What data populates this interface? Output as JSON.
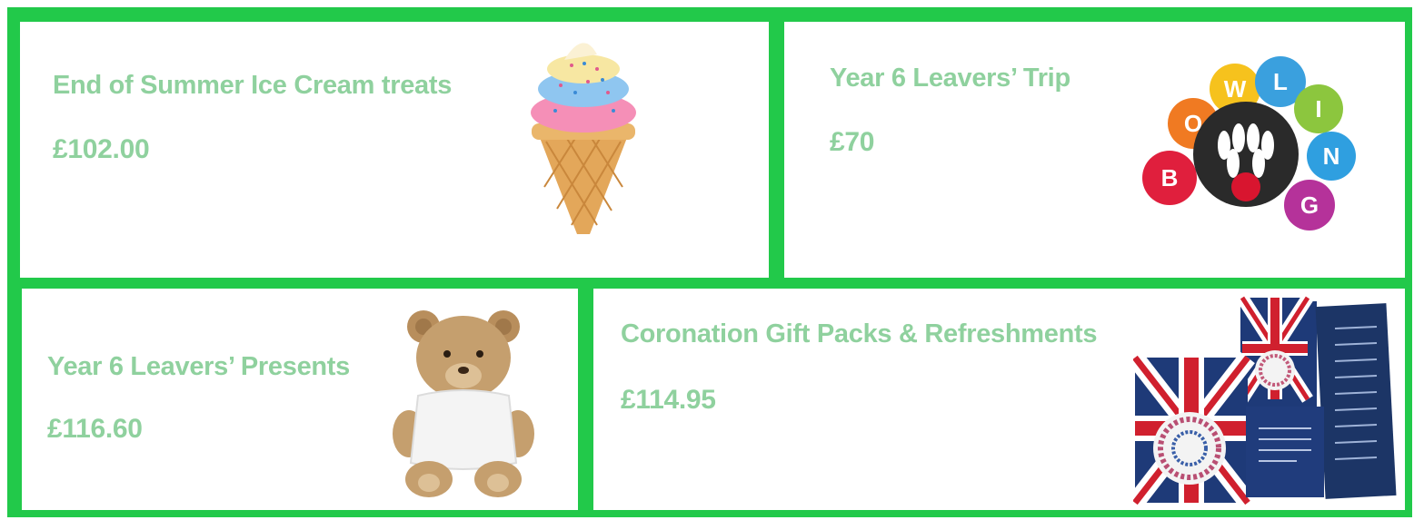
{
  "colors": {
    "frame": "#22c94a",
    "text": "#8fd19e",
    "panel": "#ffffff"
  },
  "items": [
    {
      "title": "End of Summer Ice Cream treats",
      "price": "£102.00",
      "icon": "ice-cream-icon"
    },
    {
      "title": "Year 6 Leavers’ Trip",
      "price": "£70",
      "icon": "bowling-icon"
    },
    {
      "title": "Year 6 Leavers’ Presents",
      "price": "£116.60",
      "icon": "teddy-bear-icon"
    },
    {
      "title": "Coronation Gift Packs & Refreshments",
      "price": "£114.95",
      "icon": "coronation-pack-icon"
    }
  ],
  "bowling_letters": [
    "B",
    "O",
    "W",
    "L",
    "I",
    "N",
    "G"
  ]
}
